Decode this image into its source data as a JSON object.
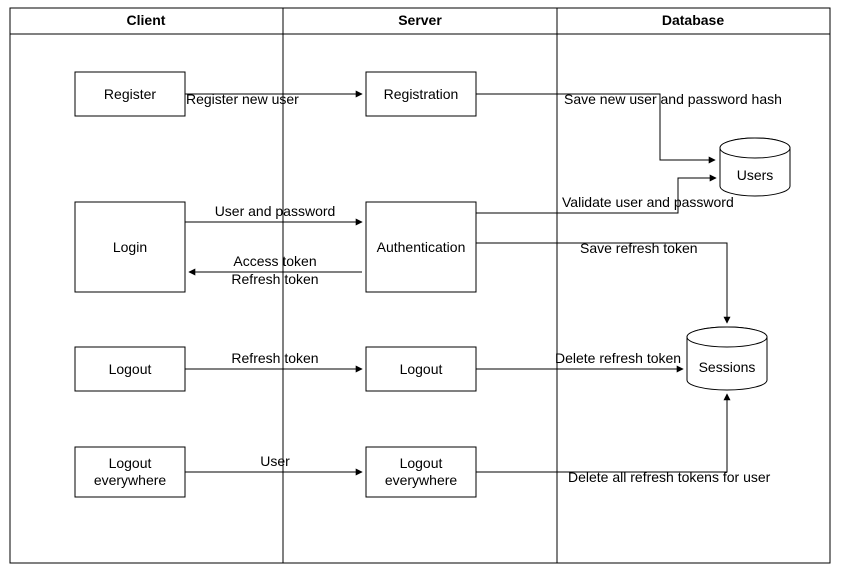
{
  "lanes": {
    "client": "Client",
    "server": "Server",
    "database": "Database"
  },
  "client_boxes": {
    "register": "Register",
    "login": "Login",
    "logout": "Logout",
    "logout_everywhere_l1": "Logout",
    "logout_everywhere_l2": "everywhere"
  },
  "server_boxes": {
    "registration": "Registration",
    "authentication": "Authentication",
    "logout": "Logout",
    "logout_everywhere_l1": "Logout",
    "logout_everywhere_l2": "everywhere"
  },
  "db_cylinders": {
    "users": "Users",
    "sessions": "Sessions"
  },
  "arrows": {
    "register_new_user": "Register new user",
    "save_new_user": "Save new user and password hash",
    "user_and_password": "User and password",
    "validate_user": "Validate user and password",
    "access_token": "Access token",
    "refresh_token_return": "Refresh token",
    "save_refresh_token": "Save refresh token",
    "refresh_token": "Refresh token",
    "delete_refresh_token": "Delete refresh token",
    "user": "User",
    "delete_all_tokens": "Delete all refresh tokens for user"
  }
}
